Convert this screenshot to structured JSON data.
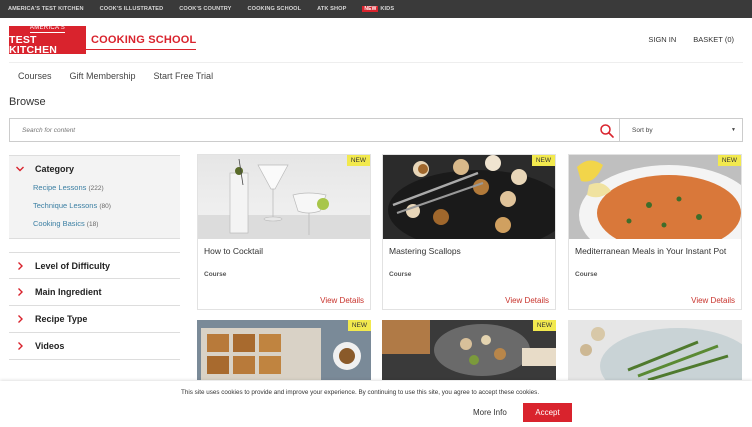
{
  "topbar": {
    "links": [
      "AMERICA'S TEST KITCHEN",
      "COOK'S ILLUSTRATED",
      "COOK'S COUNTRY",
      "COOKING SCHOOL",
      "ATK SHOP"
    ],
    "kids_new": "NEW",
    "kids": "KIDS"
  },
  "header": {
    "logo_top": "AMERICA'S",
    "logo_main": "TEST KITCHEN",
    "logo_school": "COOKING SCHOOL",
    "sign_in": "SIGN IN",
    "basket": "BASKET (0)"
  },
  "nav": [
    "Courses",
    "Gift Membership",
    "Start Free Trial"
  ],
  "browse_title": "Browse",
  "search": {
    "placeholder": "Search for content"
  },
  "sort": {
    "label": "Sort by"
  },
  "sidebar": {
    "category": {
      "title": "Category",
      "items": [
        {
          "label": "Recipe Lessons",
          "count": "(222)"
        },
        {
          "label": "Technique Lessons",
          "count": "(80)"
        },
        {
          "label": "Cooking Basics",
          "count": "(18)"
        }
      ]
    },
    "filters": [
      "Level of Difficulty",
      "Main Ingredient",
      "Recipe Type",
      "Videos"
    ]
  },
  "cards": [
    {
      "title": "How to Cocktail",
      "type": "Course",
      "link": "View Details",
      "badge": "NEW"
    },
    {
      "title": "Mastering Scallops",
      "type": "Course",
      "link": "View Details",
      "badge": "NEW"
    },
    {
      "title": "Mediterranean Meals in Your Instant Pot",
      "type": "Course",
      "link": "View Details",
      "badge": "NEW"
    }
  ],
  "row2_badges": [
    "NEW",
    "NEW"
  ],
  "cookie": {
    "text": "This site uses cookies to provide and improve your experience. By continuing to use this site, you agree to accept these cookies.",
    "more_info": "More Info",
    "accept": "Accept"
  },
  "colors": {
    "brand_red": "#d9232d",
    "link_red": "#c8332c",
    "badge_yellow": "#f2e94e",
    "category_blue": "#3b7fa3",
    "topbar": "#3a3a3a"
  }
}
